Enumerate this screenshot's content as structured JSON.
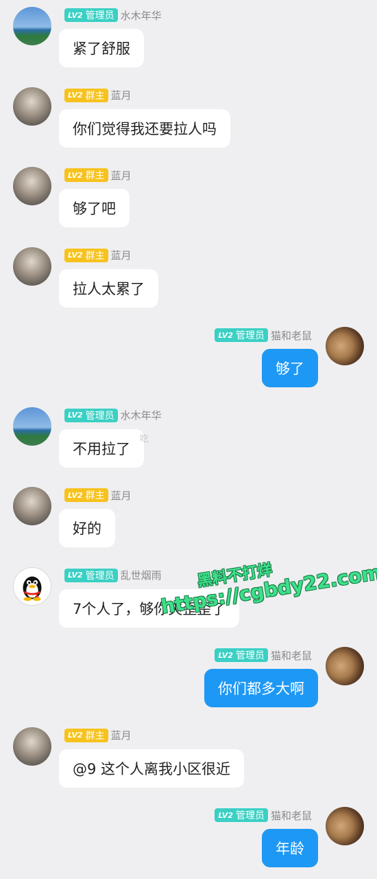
{
  "colors": {
    "background": "#efeff1",
    "admin_badge": "#3bd0c4",
    "owner_badge": "#f7c21d",
    "own_bubble": "#1e98f5",
    "other_bubble": "#ffffff",
    "watermark": "#3ee08a"
  },
  "messages": [
    {
      "side": "left",
      "avatar": "sky-avatar",
      "badge": {
        "level": "LV2",
        "role": "管理员",
        "kind": "admin"
      },
      "nick": "水木年华",
      "text": "紧了舒服"
    },
    {
      "side": "left",
      "avatar": "girl-avatar",
      "badge": {
        "level": "LV2",
        "role": "群主",
        "kind": "owner"
      },
      "nick": "蓝月",
      "text": "你们觉得我还要拉人吗"
    },
    {
      "side": "left",
      "avatar": "girl-avatar",
      "badge": {
        "level": "LV2",
        "role": "群主",
        "kind": "owner"
      },
      "nick": "蓝月",
      "text": "够了吧"
    },
    {
      "side": "left",
      "avatar": "girl-avatar",
      "badge": {
        "level": "LV2",
        "role": "群主",
        "kind": "owner"
      },
      "nick": "蓝月",
      "text": "拉人太累了"
    },
    {
      "side": "right",
      "avatar": "cat-avatar",
      "badge": {
        "level": "LV2",
        "role": "管理员",
        "kind": "admin"
      },
      "nick": "猫和老鼠",
      "text": "够了"
    },
    {
      "side": "left",
      "avatar": "sky-avatar",
      "badge": {
        "level": "LV2",
        "role": "管理员",
        "kind": "admin"
      },
      "nick": "水木年华",
      "text": "不用拉了"
    },
    {
      "side": "left",
      "avatar": "girl-avatar",
      "badge": {
        "level": "LV2",
        "role": "群主",
        "kind": "owner"
      },
      "nick": "蓝月",
      "text": "好的"
    },
    {
      "side": "left",
      "avatar": "qq-penguin-avatar",
      "badge": {
        "level": "LV2",
        "role": "管理员",
        "kind": "admin"
      },
      "nick": "乱世烟雨",
      "text": "7个人了，够你爽歪歪了"
    },
    {
      "side": "right",
      "avatar": "cat-avatar",
      "badge": {
        "level": "LV2",
        "role": "管理员",
        "kind": "admin"
      },
      "nick": "猫和老鼠",
      "text": "你们都多大啊"
    },
    {
      "side": "left",
      "avatar": "girl-avatar",
      "badge": {
        "level": "LV2",
        "role": "群主",
        "kind": "owner"
      },
      "nick": "蓝月",
      "text": "@9 这个人离我小区很近"
    },
    {
      "side": "right",
      "avatar": "cat-avatar",
      "badge": {
        "level": "LV2",
        "role": "管理员",
        "kind": "admin"
      },
      "nick": "猫和老鼠",
      "text": "年龄"
    }
  ],
  "watermark": {
    "line1": "黑料不打烊",
    "line2": "https://cgbdy22.com"
  },
  "ghost_text": "吃"
}
